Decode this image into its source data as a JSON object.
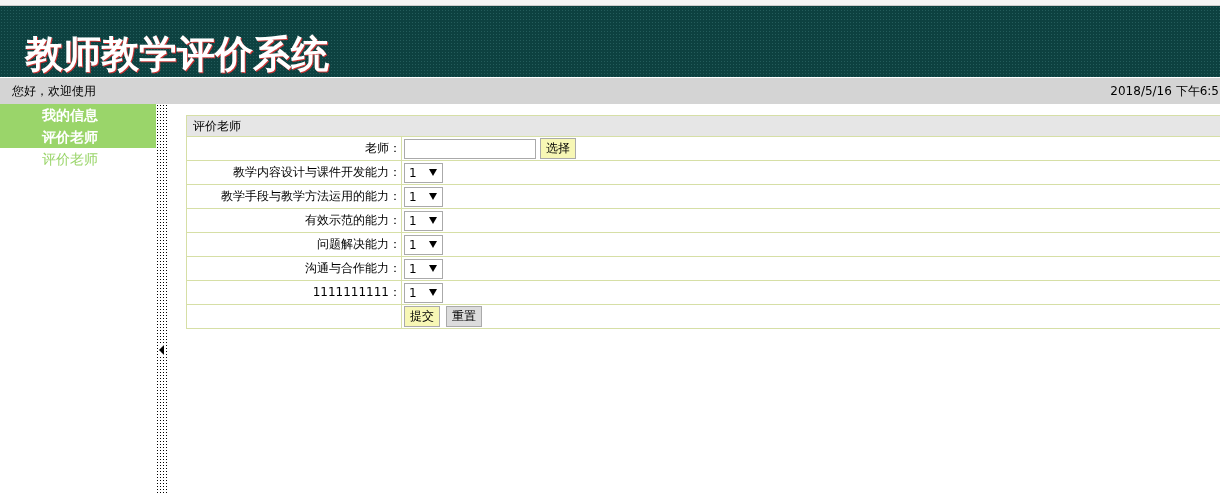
{
  "header": {
    "title": "教师教学评价系统"
  },
  "status_bar": {
    "greeting": "您好，欢迎使用",
    "datetime": "2018/5/16 下午6:5"
  },
  "sidebar": {
    "items": [
      {
        "label": "我的信息",
        "kind": "header"
      },
      {
        "label": "评价老师",
        "kind": "header"
      },
      {
        "label": "评价老师",
        "kind": "link"
      }
    ]
  },
  "form": {
    "title": "评价老师",
    "teacher": {
      "label": "老师：",
      "button": "选择"
    },
    "criteria": [
      {
        "label": "教学内容设计与课件开发能力：",
        "value": "1"
      },
      {
        "label": "教学手段与教学方法运用的能力：",
        "value": "1"
      },
      {
        "label": "有效示范的能力：",
        "value": "1"
      },
      {
        "label": "问题解决能力：",
        "value": "1"
      },
      {
        "label": "沟通与合作能力：",
        "value": "1"
      },
      {
        "label": "1111111111：",
        "value": "1"
      }
    ],
    "buttons": [
      {
        "label": "提交",
        "kind": "primary"
      },
      {
        "label": "重置",
        "kind": "secondary"
      }
    ]
  }
}
